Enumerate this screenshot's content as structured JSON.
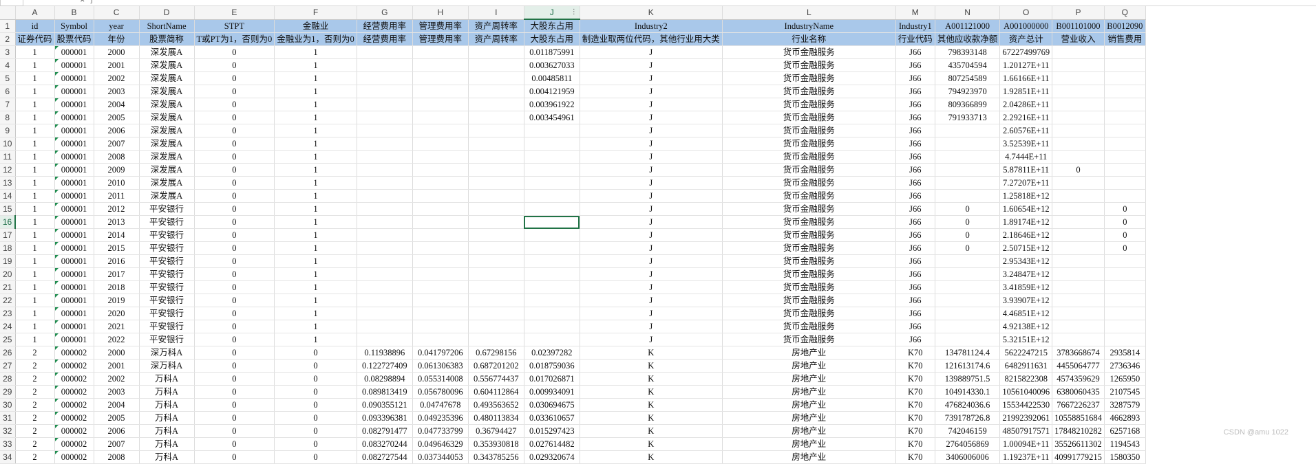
{
  "columns": [
    "A",
    "B",
    "C",
    "D",
    "E",
    "F",
    "G",
    "H",
    "I",
    "J",
    "K",
    "L",
    "M",
    "N",
    "O",
    "P",
    "Q"
  ],
  "selected_column": "J",
  "selected_row": "16",
  "header_rows": [
    [
      "id",
      "Symbol",
      "year",
      "ShortName",
      "STPT",
      "金融业",
      "经营费用率",
      "管理费用率",
      "资产周转率",
      "大股东占用",
      "Industry2",
      "IndustryName",
      "Industry1",
      "A001121000",
      "A001000000",
      "B001101000",
      "B0012090"
    ],
    [
      "证券代码",
      "股票代码",
      "年份",
      "股票简称",
      "T或PT为1，否则为0",
      "金融业为1，否则为0",
      "经营费用率",
      "管理费用率",
      "资产周转率",
      "大股东占用",
      "制造业取两位代码，其他行业用大类",
      "行业名称",
      "行业代码",
      "其他应收款净额",
      "资产总计",
      "营业收入",
      "销售费用"
    ]
  ],
  "rows": [
    [
      "1",
      "000001",
      "2000",
      "深发展A",
      "0",
      "1",
      "",
      "",
      "",
      "0.011875991",
      "J",
      "货币金融服务",
      "J66",
      "798393148",
      "67227499769",
      "",
      ""
    ],
    [
      "1",
      "000001",
      "2001",
      "深发展A",
      "0",
      "1",
      "",
      "",
      "",
      "0.003627033",
      "J",
      "货币金融服务",
      "J66",
      "435704594",
      "1.20127E+11",
      "",
      ""
    ],
    [
      "1",
      "000001",
      "2002",
      "深发展A",
      "0",
      "1",
      "",
      "",
      "",
      "0.00485811",
      "J",
      "货币金融服务",
      "J66",
      "807254589",
      "1.66166E+11",
      "",
      ""
    ],
    [
      "1",
      "000001",
      "2003",
      "深发展A",
      "0",
      "1",
      "",
      "",
      "",
      "0.004121959",
      "J",
      "货币金融服务",
      "J66",
      "794923970",
      "1.92851E+11",
      "",
      ""
    ],
    [
      "1",
      "000001",
      "2004",
      "深发展A",
      "0",
      "1",
      "",
      "",
      "",
      "0.003961922",
      "J",
      "货币金融服务",
      "J66",
      "809366899",
      "2.04286E+11",
      "",
      ""
    ],
    [
      "1",
      "000001",
      "2005",
      "深发展A",
      "0",
      "1",
      "",
      "",
      "",
      "0.003454961",
      "J",
      "货币金融服务",
      "J66",
      "791933713",
      "2.29216E+11",
      "",
      ""
    ],
    [
      "1",
      "000001",
      "2006",
      "深发展A",
      "0",
      "1",
      "",
      "",
      "",
      "",
      "J",
      "货币金融服务",
      "J66",
      "",
      "2.60576E+11",
      "",
      ""
    ],
    [
      "1",
      "000001",
      "2007",
      "深发展A",
      "0",
      "1",
      "",
      "",
      "",
      "",
      "J",
      "货币金融服务",
      "J66",
      "",
      "3.52539E+11",
      "",
      ""
    ],
    [
      "1",
      "000001",
      "2008",
      "深发展A",
      "0",
      "1",
      "",
      "",
      "",
      "",
      "J",
      "货币金融服务",
      "J66",
      "",
      "4.7444E+11",
      "",
      ""
    ],
    [
      "1",
      "000001",
      "2009",
      "深发展A",
      "0",
      "1",
      "",
      "",
      "",
      "",
      "J",
      "货币金融服务",
      "J66",
      "",
      "5.87811E+11",
      "0",
      ""
    ],
    [
      "1",
      "000001",
      "2010",
      "深发展A",
      "0",
      "1",
      "",
      "",
      "",
      "",
      "J",
      "货币金融服务",
      "J66",
      "",
      "7.27207E+11",
      "",
      ""
    ],
    [
      "1",
      "000001",
      "2011",
      "深发展A",
      "0",
      "1",
      "",
      "",
      "",
      "",
      "J",
      "货币金融服务",
      "J66",
      "",
      "1.25818E+12",
      "",
      ""
    ],
    [
      "1",
      "000001",
      "2012",
      "平安银行",
      "0",
      "1",
      "",
      "",
      "",
      "",
      "J",
      "货币金融服务",
      "J66",
      "0",
      "1.60654E+12",
      "",
      "0"
    ],
    [
      "1",
      "000001",
      "2013",
      "平安银行",
      "0",
      "1",
      "",
      "",
      "",
      "",
      "J",
      "货币金融服务",
      "J66",
      "0",
      "1.89174E+12",
      "",
      "0"
    ],
    [
      "1",
      "000001",
      "2014",
      "平安银行",
      "0",
      "1",
      "",
      "",
      "",
      "",
      "J",
      "货币金融服务",
      "J66",
      "0",
      "2.18646E+12",
      "",
      "0"
    ],
    [
      "1",
      "000001",
      "2015",
      "平安银行",
      "0",
      "1",
      "",
      "",
      "",
      "",
      "J",
      "货币金融服务",
      "J66",
      "0",
      "2.50715E+12",
      "",
      "0"
    ],
    [
      "1",
      "000001",
      "2016",
      "平安银行",
      "0",
      "1",
      "",
      "",
      "",
      "",
      "J",
      "货币金融服务",
      "J66",
      "",
      "2.95343E+12",
      "",
      ""
    ],
    [
      "1",
      "000001",
      "2017",
      "平安银行",
      "0",
      "1",
      "",
      "",
      "",
      "",
      "J",
      "货币金融服务",
      "J66",
      "",
      "3.24847E+12",
      "",
      ""
    ],
    [
      "1",
      "000001",
      "2018",
      "平安银行",
      "0",
      "1",
      "",
      "",
      "",
      "",
      "J",
      "货币金融服务",
      "J66",
      "",
      "3.41859E+12",
      "",
      ""
    ],
    [
      "1",
      "000001",
      "2019",
      "平安银行",
      "0",
      "1",
      "",
      "",
      "",
      "",
      "J",
      "货币金融服务",
      "J66",
      "",
      "3.93907E+12",
      "",
      ""
    ],
    [
      "1",
      "000001",
      "2020",
      "平安银行",
      "0",
      "1",
      "",
      "",
      "",
      "",
      "J",
      "货币金融服务",
      "J66",
      "",
      "4.46851E+12",
      "",
      ""
    ],
    [
      "1",
      "000001",
      "2021",
      "平安银行",
      "0",
      "1",
      "",
      "",
      "",
      "",
      "J",
      "货币金融服务",
      "J66",
      "",
      "4.92138E+12",
      "",
      ""
    ],
    [
      "1",
      "000001",
      "2022",
      "平安银行",
      "0",
      "1",
      "",
      "",
      "",
      "",
      "J",
      "货币金融服务",
      "J66",
      "",
      "5.32151E+12",
      "",
      ""
    ],
    [
      "2",
      "000002",
      "2000",
      "深万科A",
      "0",
      "0",
      "0.11938896",
      "0.041797206",
      "0.67298156",
      "0.02397282",
      "K",
      "房地产业",
      "K70",
      "134781124.4",
      "5622247215",
      "3783668674",
      "2935814"
    ],
    [
      "2",
      "000002",
      "2001",
      "深万科A",
      "0",
      "0",
      "0.122727409",
      "0.061306383",
      "0.687201202",
      "0.018759036",
      "K",
      "房地产业",
      "K70",
      "121613174.6",
      "6482911631",
      "4455064777",
      "2736346"
    ],
    [
      "2",
      "000002",
      "2002",
      "万科A",
      "0",
      "0",
      "0.08298894",
      "0.055314008",
      "0.556774437",
      "0.017026871",
      "K",
      "房地产业",
      "K70",
      "139889751.5",
      "8215822308",
      "4574359629",
      "1265950"
    ],
    [
      "2",
      "000002",
      "2003",
      "万科A",
      "0",
      "0",
      "0.089813419",
      "0.056780096",
      "0.604112864",
      "0.009934091",
      "K",
      "房地产业",
      "K70",
      "104914330.1",
      "10561040096",
      "6380060435",
      "2107545"
    ],
    [
      "2",
      "000002",
      "2004",
      "万科A",
      "0",
      "0",
      "0.090355121",
      "0.04747678",
      "0.493563652",
      "0.030694675",
      "K",
      "房地产业",
      "K70",
      "476824036.6",
      "15534422530",
      "7667226237",
      "3287579"
    ],
    [
      "2",
      "000002",
      "2005",
      "万科A",
      "0",
      "0",
      "0.093396381",
      "0.049235396",
      "0.480113834",
      "0.033610657",
      "K",
      "房地产业",
      "K70",
      "739178726.8",
      "21992392061",
      "10558851684",
      "4662893"
    ],
    [
      "2",
      "000002",
      "2006",
      "万科A",
      "0",
      "0",
      "0.082791477",
      "0.047733799",
      "0.36794427",
      "0.015297423",
      "K",
      "房地产业",
      "K70",
      "742046159",
      "48507917571",
      "17848210282",
      "6257168"
    ],
    [
      "2",
      "000002",
      "2007",
      "万科A",
      "0",
      "0",
      "0.083270244",
      "0.049646329",
      "0.353930818",
      "0.027614482",
      "K",
      "房地产业",
      "K70",
      "2764056869",
      "1.00094E+11",
      "35526611302",
      "1194543"
    ],
    [
      "2",
      "000002",
      "2008",
      "万科A",
      "0",
      "0",
      "0.082727544",
      "0.037344053",
      "0.343785256",
      "0.029320674",
      "K",
      "房地产业",
      "K70",
      "3406006006",
      "1.19237E+11",
      "40991779215",
      "1580350"
    ]
  ],
  "watermark": "CSDN @amu 1022"
}
